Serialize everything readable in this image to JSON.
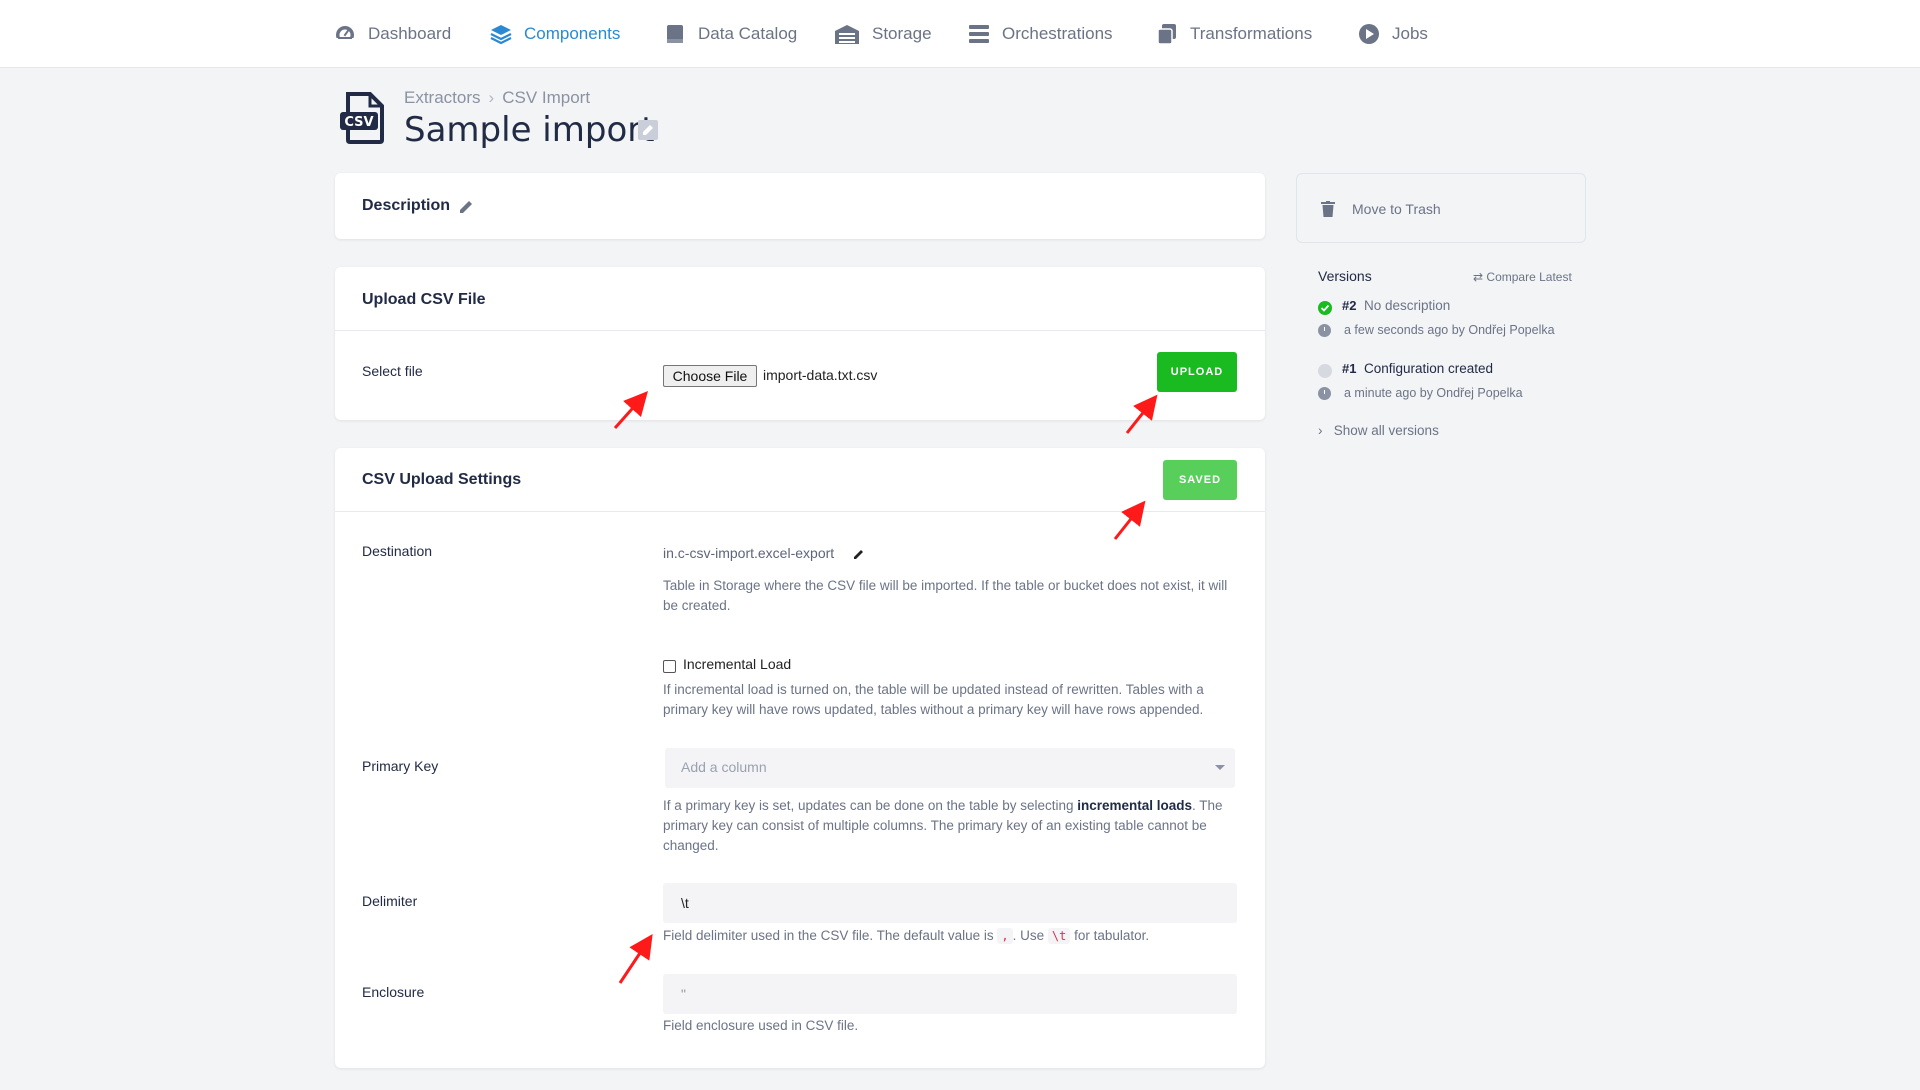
{
  "nav": {
    "items": [
      {
        "label": "Dashboard",
        "icon": "dashboard-gauge-icon"
      },
      {
        "label": "Components",
        "icon": "layers-icon"
      },
      {
        "label": "Data Catalog",
        "icon": "book-icon"
      },
      {
        "label": "Storage",
        "icon": "warehouse-icon"
      },
      {
        "label": "Orchestrations",
        "icon": "list-bars-icon"
      },
      {
        "label": "Transformations",
        "icon": "copy-icon"
      },
      {
        "label": "Jobs",
        "icon": "play-circle-icon"
      }
    ],
    "active": "Components",
    "active_color": "#2b89d4"
  },
  "header": {
    "breadcrumb": [
      "Extractors",
      "CSV Import"
    ],
    "title": "Sample import",
    "icon": "csv-file-icon"
  },
  "description_card": {
    "title": "Description"
  },
  "upload_card": {
    "title": "Upload CSV File",
    "select_label": "Select file",
    "choose_file_label": "Choose File",
    "file_name": "import-data.txt.csv",
    "upload_button": "UPLOAD"
  },
  "settings_card": {
    "title": "CSV Upload Settings",
    "saved_button": "SAVED",
    "destination": {
      "label": "Destination",
      "value": "in.c-csv-import.excel-export",
      "help": "Table in Storage where the CSV file will be imported. If the table or bucket does not exist, it will be created."
    },
    "incremental": {
      "label": "Incremental Load",
      "checked": false,
      "help": "If incremental load is turned on, the table will be updated instead of rewritten. Tables with a primary key will have rows updated, tables without a primary key will have rows appended."
    },
    "primary_key": {
      "label": "Primary Key",
      "placeholder": "Add a column",
      "help_pre": "If a primary key is set, updates can be done on the table by selecting ",
      "help_bold": "incremental loads",
      "help_post": ". The primary key can consist of multiple columns. The primary key of an existing table cannot be changed."
    },
    "delimiter": {
      "label": "Delimiter",
      "value": "\\t",
      "help_pre": "Field delimiter used in the CSV file. The default value is ",
      "help_code1": ",",
      "help_mid": ". Use ",
      "help_code2": "\\t",
      "help_post": " for tabulator."
    },
    "enclosure": {
      "label": "Enclosure",
      "value": "\"",
      "help": "Field enclosure used in CSV file."
    }
  },
  "sidebar": {
    "trash_label": "Move to Trash",
    "versions_title": "Versions",
    "compare_label": "Compare Latest",
    "versions": [
      {
        "num": "#2",
        "desc": "No description",
        "meta": "a few seconds ago by Ondřej Popelka",
        "status_color": "#1aba21"
      },
      {
        "num": "#1",
        "desc": "Configuration created",
        "meta": "a minute ago by Ondřej Popelka",
        "status_color": "#d6d9e0"
      }
    ],
    "show_all": "Show all versions"
  },
  "colors": {
    "upload_green": "#1aba21",
    "saved_green": "#58cf5b",
    "annotation_red": "#ff1a1a"
  }
}
